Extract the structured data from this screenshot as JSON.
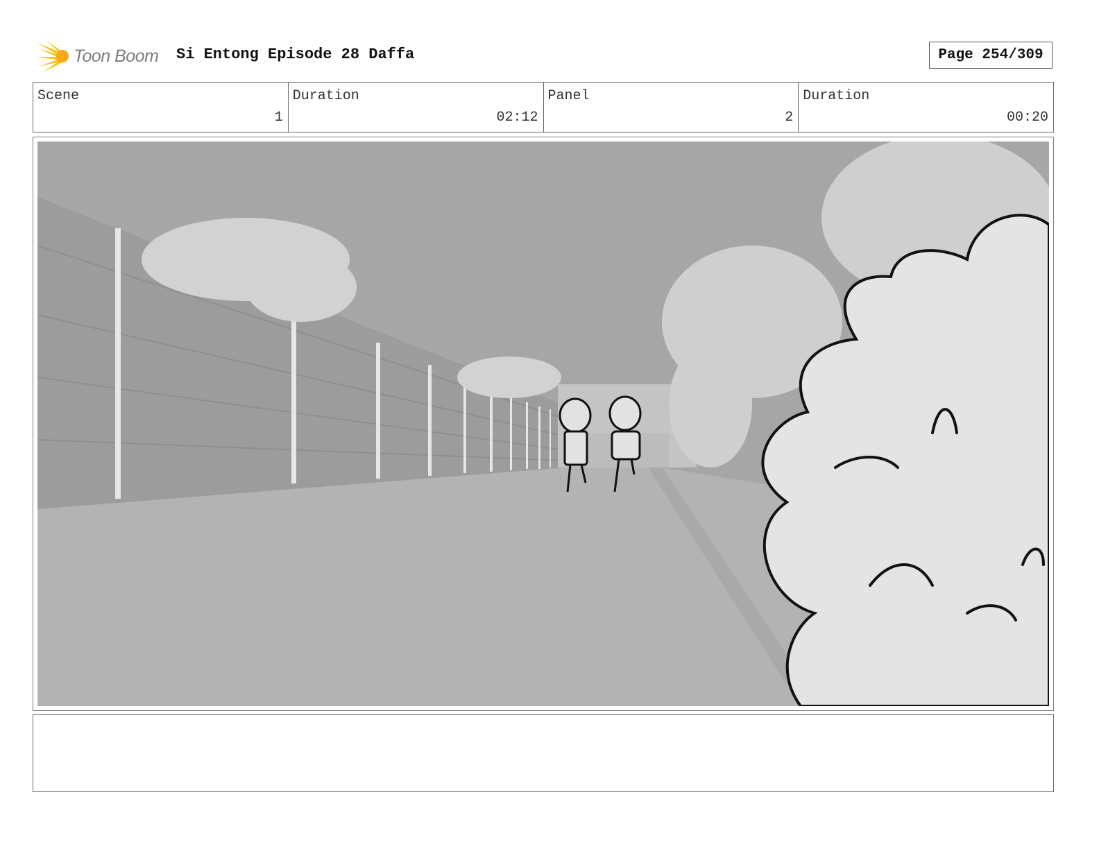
{
  "header": {
    "logo_text": "Toon Boom",
    "title": "Si Entong Episode 28 Daffa",
    "page": "Page 254/309"
  },
  "info": {
    "scene_label": "Scene",
    "scene_value": "1",
    "scene_duration_label": "Duration",
    "scene_duration_value": "02:12",
    "panel_label": "Panel",
    "panel_value": "2",
    "panel_duration_label": "Duration",
    "panel_duration_value": "00:20"
  },
  "notes": {
    "text": ""
  },
  "colors": {
    "logo_flare": "#f5c518",
    "logo_text": "#7d7d7d",
    "sky": "#a6a6a6",
    "road": "#b4b4b4",
    "wall": "#9c9c9c",
    "bush_fill": "#e4e4e4"
  },
  "icons": {
    "logo": "toon-boom-flare-icon"
  }
}
